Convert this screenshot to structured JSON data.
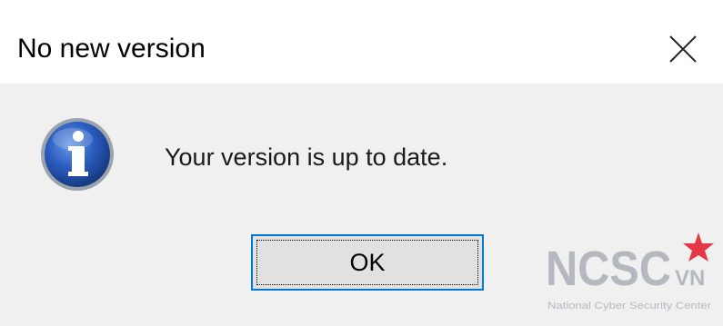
{
  "dialog": {
    "title": "No new version",
    "message": "Your version is up to date.",
    "ok_label": "OK"
  },
  "icons": {
    "info": "information-icon",
    "close": "close-icon"
  },
  "watermark": {
    "logo_text": "NCSC",
    "logo_suffix": "VN",
    "subtitle": "National Cyber Security Center"
  },
  "colors": {
    "titlebar_bg": "#ffffff",
    "dialog_bg": "#f0f0f0",
    "button_border": "#0078d7",
    "button_bg": "#e1e1e1",
    "icon_blue": "#1f4fa8",
    "watermark_gray": "#b5b9bf",
    "watermark_red": "#e5394a"
  }
}
